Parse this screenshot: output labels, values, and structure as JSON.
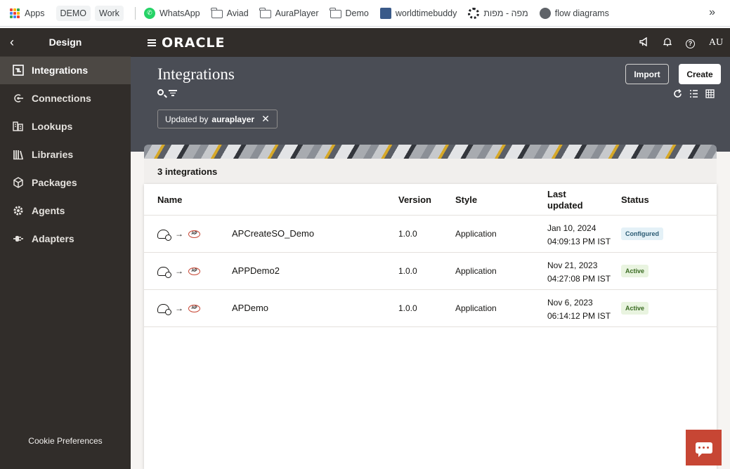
{
  "bookmarks": {
    "apps": "Apps",
    "demo": "DEMO",
    "work": "Work",
    "whatsapp": "WhatsApp",
    "aviad": "Aviad",
    "auraplayer": "AuraPlayer",
    "demo_folder": "Demo",
    "worldtimebuddy": "worldtimebuddy",
    "maps": "מפה - מפות",
    "flow": "flow diagrams",
    "more": "»"
  },
  "sidebar": {
    "back": "‹",
    "title": "Design",
    "items": [
      {
        "label": "Integrations",
        "icon": "integrations-icon"
      },
      {
        "label": "Connections",
        "icon": "connections-icon"
      },
      {
        "label": "Lookups",
        "icon": "lookups-icon"
      },
      {
        "label": "Libraries",
        "icon": "libraries-icon"
      },
      {
        "label": "Packages",
        "icon": "packages-icon"
      },
      {
        "label": "Agents",
        "icon": "agents-icon"
      },
      {
        "label": "Adapters",
        "icon": "adapters-icon"
      }
    ],
    "cookie": "Cookie Preferences"
  },
  "topbar": {
    "logo": "ORACLE",
    "user": "AU"
  },
  "page": {
    "title": "Integrations",
    "import_label": "Import",
    "create_label": "Create",
    "filter_prefix": "Updated by",
    "filter_value": "auraplayer",
    "filter_clear": "✕"
  },
  "table": {
    "summary": "3 integrations",
    "headers": {
      "name": "Name",
      "version": "Version",
      "style": "Style",
      "last_updated_1": "Last",
      "last_updated_2": "updated",
      "status": "Status"
    },
    "rows": [
      {
        "name": "APCreateSO_Demo",
        "version": "1.0.0",
        "style": "Application",
        "date": "Jan 10, 2024",
        "time": "04:09:13 PM IST",
        "status": "Configured"
      },
      {
        "name": "APPDemo2",
        "version": "1.0.0",
        "style": "Application",
        "date": "Nov 21, 2023",
        "time": "04:27:08 PM IST",
        "status": "Active"
      },
      {
        "name": "APDemo",
        "version": "1.0.0",
        "style": "Application",
        "date": "Nov 6, 2023",
        "time": "06:14:12 PM IST",
        "status": "Active"
      }
    ],
    "ap_badge": "AP",
    "arrow": "→"
  },
  "colors": {
    "sidebar_bg": "#312d2a",
    "header_bg": "#4a4d55",
    "accent": "#c74634"
  }
}
